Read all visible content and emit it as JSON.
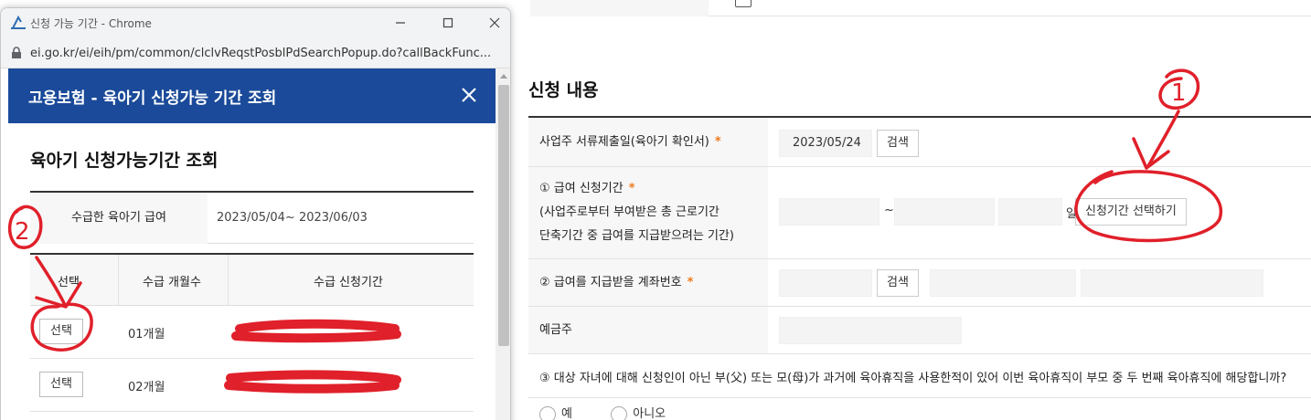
{
  "popup": {
    "window_title": "신청 가능 기간 - Chrome",
    "url": "ei.go.kr/ei/eih/pm/common/clclvReqstPosblPdSearchPopup.do?callBackFunc...",
    "header_title": "고용보험 - 육아기 신청가능 기간 조회",
    "heading": "육아기 신청가능기간 조회",
    "info_label": "수급한 육아기 급여",
    "info_value": "2023/05/04~ 2023/06/03",
    "columns": [
      "선택",
      "수급 개월수",
      "수급 신청기간"
    ],
    "rows": [
      {
        "select_label": "선택",
        "months": "01개월"
      },
      {
        "select_label": "선택",
        "months": "02개월"
      }
    ]
  },
  "main": {
    "section_title": "신청 내용",
    "employer_doc_label": "사업주 서류제출일(육아기 확인서)",
    "employer_doc_date": "2023/05/24",
    "search_label": "검색",
    "period_label_1": "① 급여 신청기간",
    "period_label_2": "(사업주로부터 부여받은 총 근로기간",
    "period_label_3": "단축기간 중 급여를 지급받으려는 기간)",
    "tilde": "~",
    "day_suffix": "일",
    "select_period_button": "신청기간 선택하기",
    "account_label": "② 급여를 지급받을 계좌번호",
    "depositor_label": "예금주",
    "question_3": "③ 대상 자녀에 대해 신청인이 아닌 부(父) 또는 모(母)가 과거에 육아휴직을 사용한적이 있어 이번 육아휴직이 부모 중 두 번째 육아휴직에 해당합니까?",
    "radio_yes": "예",
    "radio_no": "아니오",
    "required_mark": "*"
  },
  "annotations": {
    "number_1": "1",
    "number_2": "2",
    "color": "#e0202a"
  }
}
